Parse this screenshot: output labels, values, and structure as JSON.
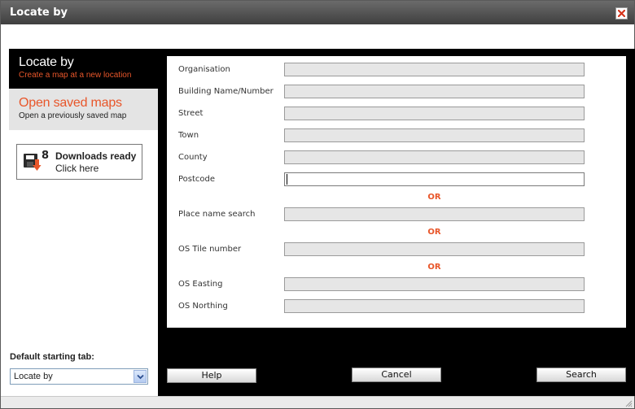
{
  "window": {
    "title": "Locate by"
  },
  "icons": {
    "close": "close-icon",
    "downloads": "downloads-icon",
    "dropdown": "chevron-down-icon"
  },
  "colors": {
    "accent": "#e8562a",
    "titlebar": "#4a4a4a",
    "panel": "#000000"
  },
  "sidebar": {
    "tabs": [
      {
        "title": "Locate by",
        "subtitle": "Create a map at a new location"
      },
      {
        "title": "Open saved maps",
        "subtitle": "Open a previously saved map"
      }
    ],
    "downloads": {
      "count": "8",
      "title": "Downloads ready",
      "link": "Click here"
    },
    "default_tab_label": "Default starting tab:",
    "default_tab_value": "Locate by"
  },
  "form": {
    "fields": [
      {
        "label": "Organisation",
        "value": ""
      },
      {
        "label": "Building Name/Number",
        "value": ""
      },
      {
        "label": "Street",
        "value": ""
      },
      {
        "label": "Town",
        "value": ""
      },
      {
        "label": "County",
        "value": ""
      },
      {
        "label": "Postcode",
        "value": ""
      },
      {
        "label": "Place name search",
        "value": ""
      },
      {
        "label": "OS Tile number",
        "value": ""
      },
      {
        "label": "OS Easting",
        "value": ""
      },
      {
        "label": "OS Northing",
        "value": ""
      }
    ],
    "separator": "OR"
  },
  "buttons": {
    "help": "Help",
    "cancel": "Cancel",
    "search": "Search"
  }
}
